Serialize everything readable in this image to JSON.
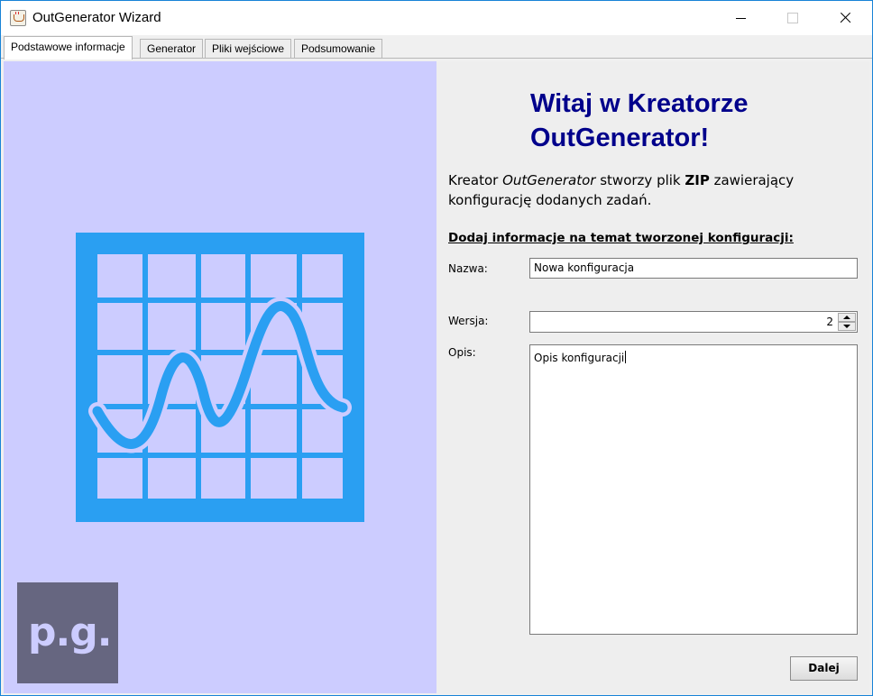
{
  "window": {
    "title": "OutGenerator Wizard",
    "border_color": "#1883d7"
  },
  "tabs": [
    {
      "label": "Podstawowe informacje",
      "active": true
    },
    {
      "label": "Generator",
      "active": false
    },
    {
      "label": "Pliki wejściowe",
      "active": false
    },
    {
      "label": "Podsumowanie",
      "active": false
    }
  ],
  "left_panel": {
    "background": "#ccccff",
    "chart_icon": "chart-grid-wave-icon",
    "logo_text": "p.g."
  },
  "welcome": {
    "heading_line1": "Witaj w Kreatorze",
    "heading_line2": "OutGenerator!",
    "heading_color": "#00008b",
    "intro_part1": "Kreator ",
    "intro_italic": "OutGenerator",
    "intro_part2": " stworzy plik ",
    "intro_bold": "ZIP",
    "intro_part3": " zawierający konfigurację dodanych zadań."
  },
  "form": {
    "section_title": "Dodaj informacje na temat tworzonej konfiguracji:",
    "name_label": "Nazwa:",
    "name_value": "Nowa konfiguracja",
    "version_label": "Wersja:",
    "version_value": "2",
    "description_label": "Opis:",
    "description_value": "Opis konfiguracji"
  },
  "buttons": {
    "next": "Dalej"
  }
}
